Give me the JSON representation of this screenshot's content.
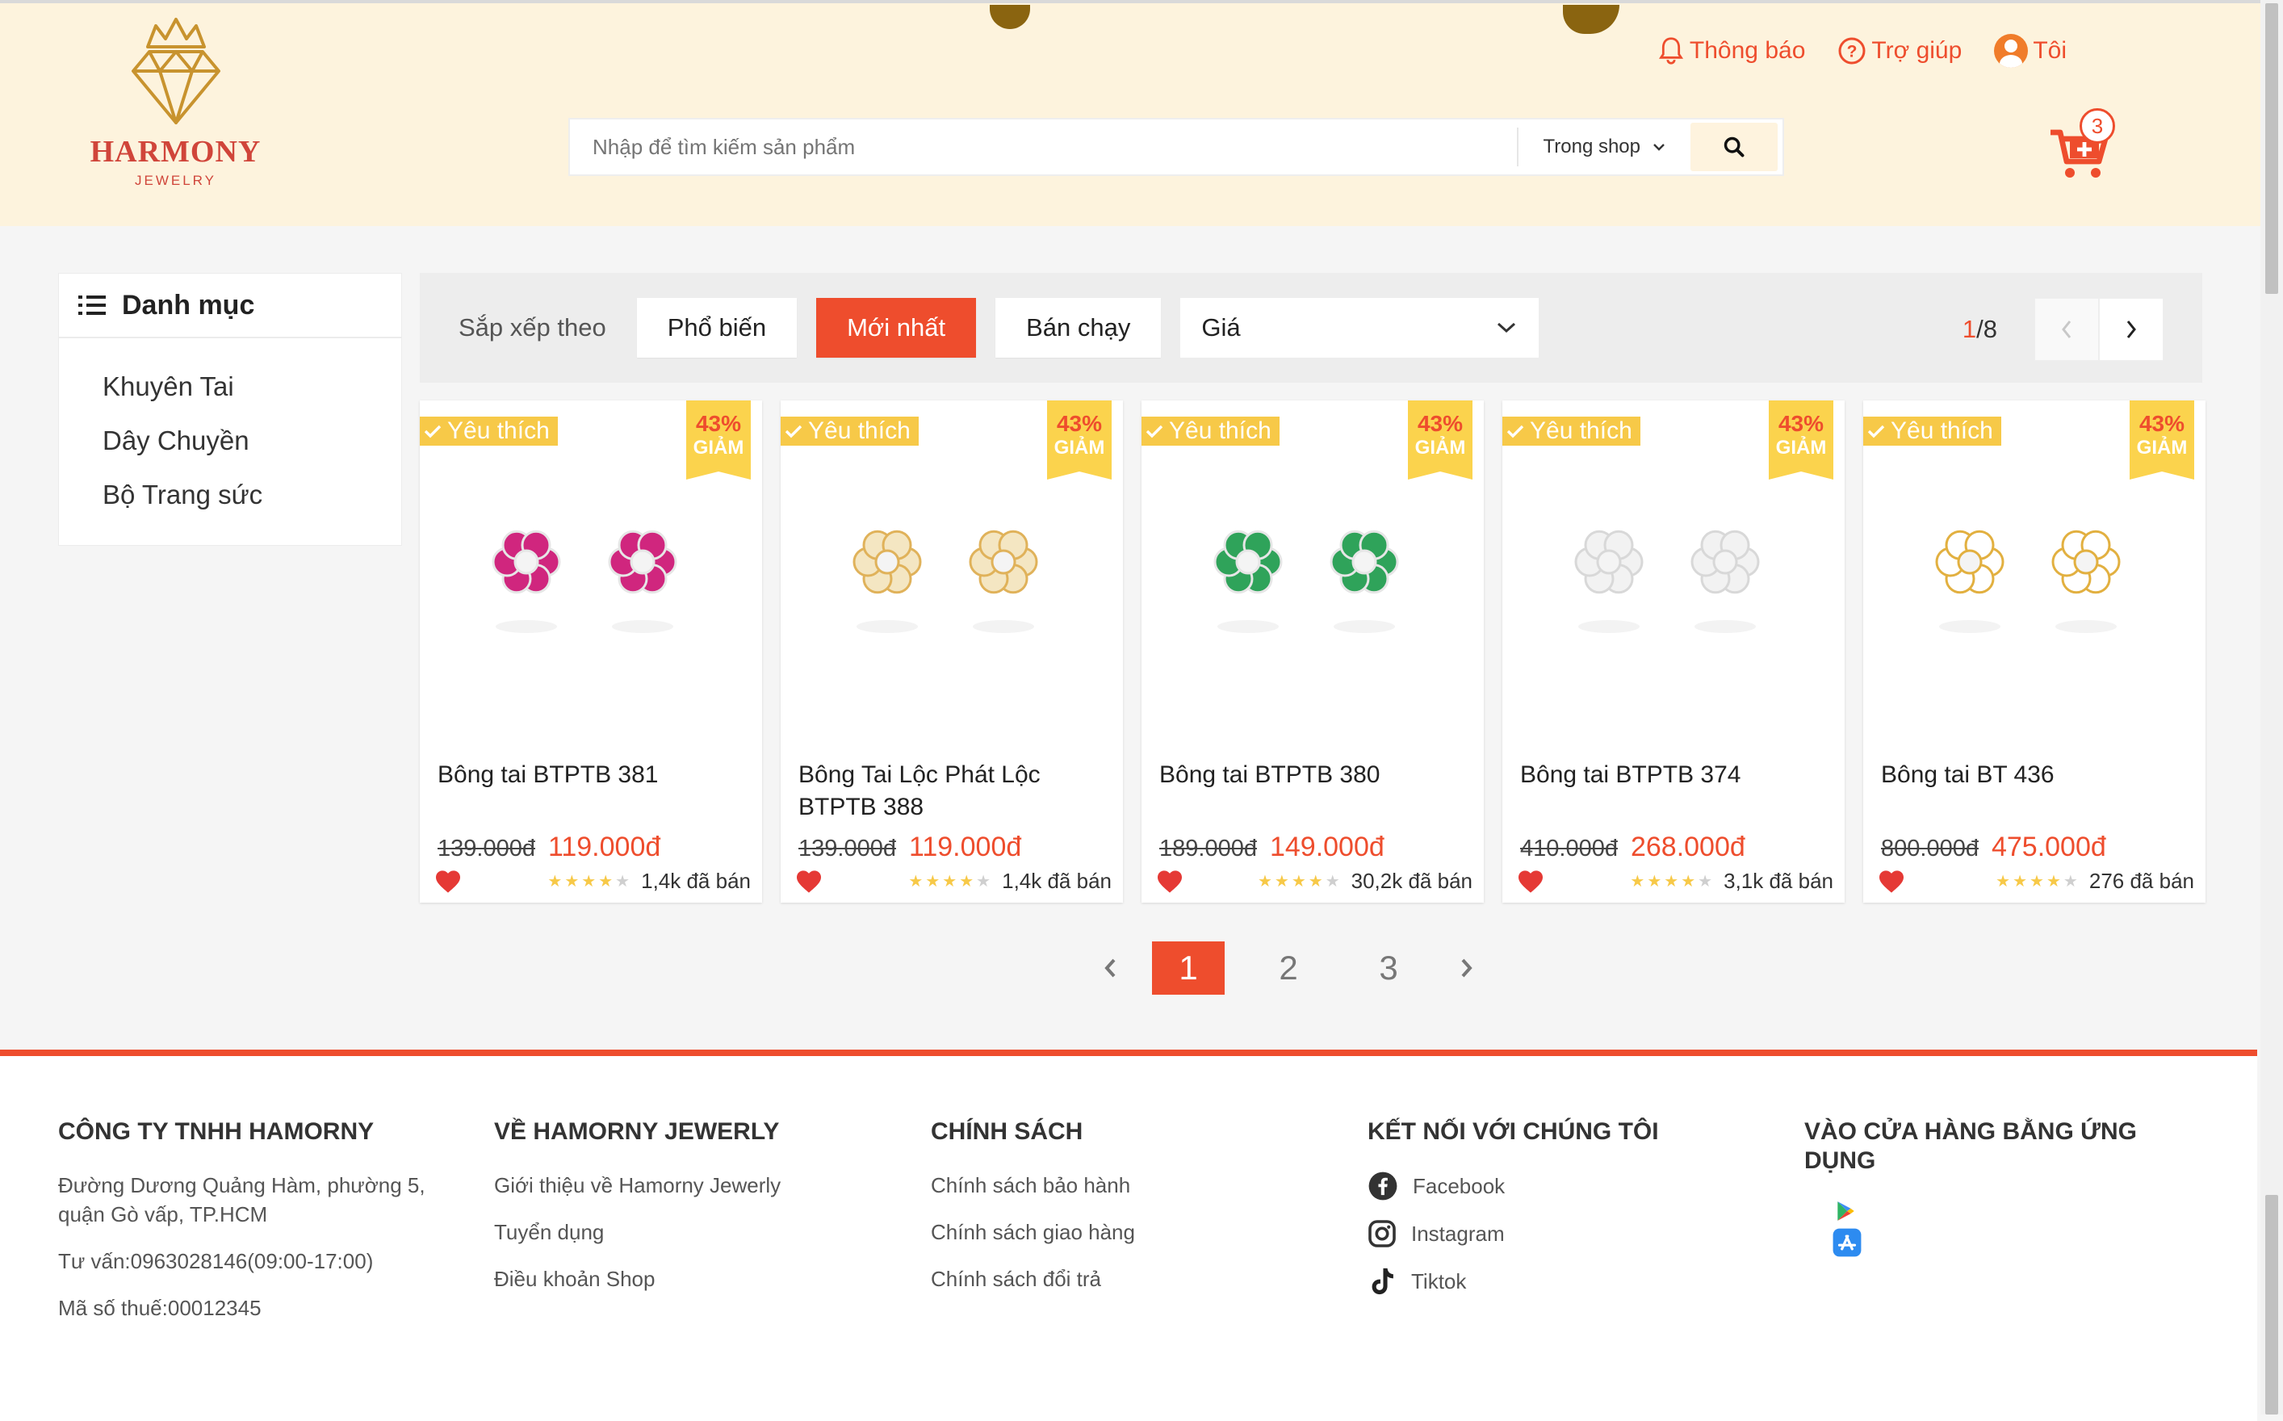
{
  "header": {
    "logo": {
      "name": "HARMONY",
      "sub": "JEWELRY"
    },
    "links": {
      "notify": "Thông báo",
      "help": "Trợ giúp",
      "account": "Tôi"
    },
    "search": {
      "placeholder": "Nhập để tìm kiếm sản phẩm",
      "scope": "Trong shop"
    },
    "cart_count": "3"
  },
  "sidebar": {
    "title": "Danh mục",
    "items": [
      {
        "label": "Khuyên Tai"
      },
      {
        "label": "Dây Chuyền"
      },
      {
        "label": "Bộ Trang sức"
      }
    ]
  },
  "sort": {
    "label": "Sắp xếp theo",
    "options": [
      "Phổ biến",
      "Mới nhất",
      "Bán chạy"
    ],
    "active": "Mới nhất",
    "price": "Giá",
    "page_current": "1",
    "page_total": "/8"
  },
  "products": [
    {
      "tag": "Yêu thích",
      "discount": "43%",
      "sale_word": "GIẢM",
      "name": "Bông tai BTPTB 381",
      "old_price": "139.000đ",
      "price": "119.000đ",
      "rating": 4,
      "sold": "1,4k đã bán",
      "gem_color": "#d0267e",
      "metal": "#e6e6e6"
    },
    {
      "tag": "Yêu thích",
      "discount": "43%",
      "sale_word": "GIẢM",
      "name": "Bông Tai Lộc Phát Lộc BTPTB 388",
      "old_price": "139.000đ",
      "price": "119.000đ",
      "rating": 4,
      "sold": "1,4k đã bán",
      "gem_color": "#f4e6c2",
      "metal": "#e0b25a"
    },
    {
      "tag": "Yêu thích",
      "discount": "43%",
      "sale_word": "GIẢM",
      "name": "Bông tai BTPTB 380",
      "old_price": "189.000đ",
      "price": "149.000đ",
      "rating": 4,
      "sold": "30,2k đã bán",
      "gem_color": "#2fa35a",
      "metal": "#e6e6e6"
    },
    {
      "tag": "Yêu thích",
      "discount": "43%",
      "sale_word": "GIẢM",
      "name": "Bông tai BTPTB 374",
      "old_price": "410.000đ",
      "price": "268.000đ",
      "rating": 4,
      "sold": "3,1k đã bán",
      "gem_color": "#f2f2f2",
      "metal": "#d8d8d8"
    },
    {
      "tag": "Yêu thích",
      "discount": "43%",
      "sale_word": "GIẢM",
      "name": "Bông tai BT 436",
      "old_price": "800.000đ",
      "price": "475.000đ",
      "rating": 4,
      "sold": "276 đã bán",
      "gem_color": "#ffffff",
      "metal": "#e2b040"
    }
  ],
  "pagination": {
    "pages": [
      "1",
      "2",
      "3"
    ],
    "active": "1"
  },
  "footer": {
    "col1": {
      "title": "CÔNG TY TNHH HAMORNY",
      "address": "Đường Dương Quảng Hàm, phường 5, quận Gò vấp, TP.HCM",
      "phone": "Tư vấn:0963028146(09:00-17:00)",
      "tax": "Mã số thuế:00012345"
    },
    "col2": {
      "title": "VỀ HAMORNY JEWERLY",
      "links": [
        "Giới thiệu về Hamorny Jewerly",
        "Tuyển dụng",
        "Điều khoản Shop"
      ]
    },
    "col3": {
      "title": "CHÍNH SÁCH",
      "links": [
        "Chính sách bảo hành",
        "Chính sách giao hàng",
        "Chính sách đổi trả"
      ]
    },
    "col4": {
      "title": "KẾT NỐI VỚI CHÚNG TÔI",
      "links": [
        "Facebook",
        "Instagram",
        "Tiktok"
      ]
    },
    "col5": {
      "title": "VÀO CỬA HÀNG BẰNG ỨNG DỤNG"
    }
  },
  "colors": {
    "accent": "#ee4d2d",
    "header_bg": "#fdf3dd",
    "tag_yellow": "#f7c948"
  }
}
